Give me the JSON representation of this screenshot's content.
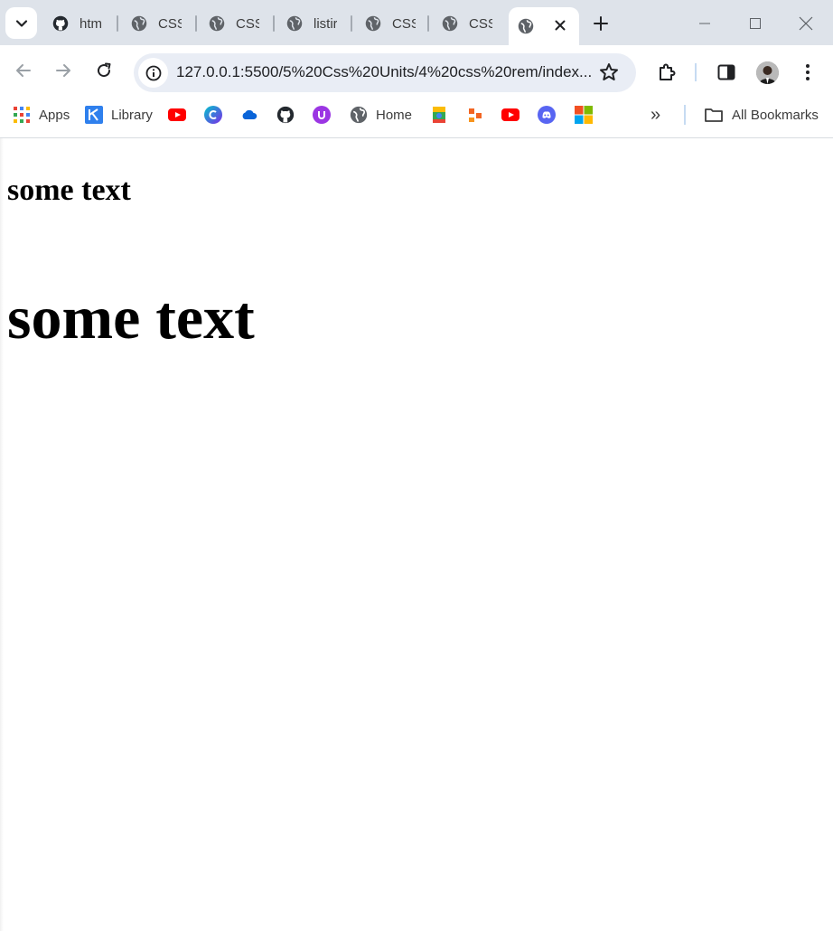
{
  "browser": {
    "tabs": [
      {
        "title": "htm",
        "icon": "github-icon",
        "active": false
      },
      {
        "title": "CSS",
        "icon": "globe-icon",
        "active": false
      },
      {
        "title": "CSS",
        "icon": "globe-icon",
        "active": false
      },
      {
        "title": "listir",
        "icon": "globe-icon",
        "active": false
      },
      {
        "title": "CSS",
        "icon": "globe-icon",
        "active": false
      },
      {
        "title": "CSS",
        "icon": "globe-icon",
        "active": false
      },
      {
        "title": "",
        "icon": "globe-icon",
        "active": true
      }
    ],
    "address": "127.0.0.1:5500/5%20Css%20Units/4%20css%20rem/index....",
    "colors": {
      "tabstrip": "#dee3ea",
      "omnibox": "#e9edf5",
      "youtube": "#ff0000",
      "discord": "#5865f2",
      "onedrive": "#0a64d8"
    }
  },
  "bookmarks": {
    "items": [
      {
        "label": "Apps",
        "icon": "apps-grid-icon"
      },
      {
        "label": "Library",
        "icon": "library-icon"
      },
      {
        "label": "",
        "icon": "youtube-icon"
      },
      {
        "label": "",
        "icon": "canva-icon"
      },
      {
        "label": "",
        "icon": "onedrive-icon"
      },
      {
        "label": "",
        "icon": "github-icon"
      },
      {
        "label": "",
        "icon": "upwork-icon"
      },
      {
        "label": "Home",
        "icon": "globe-icon"
      },
      {
        "label": "",
        "icon": "google-maps-icon"
      },
      {
        "label": "",
        "icon": "orange-app-icon"
      },
      {
        "label": "",
        "icon": "youtube-icon"
      },
      {
        "label": "",
        "icon": "discord-icon"
      },
      {
        "label": "",
        "icon": "microsoft-icon"
      }
    ],
    "overflow": "»",
    "all_bookmarks": "All Bookmarks"
  },
  "content": {
    "heading_small": "some text",
    "heading_large": "some text"
  }
}
